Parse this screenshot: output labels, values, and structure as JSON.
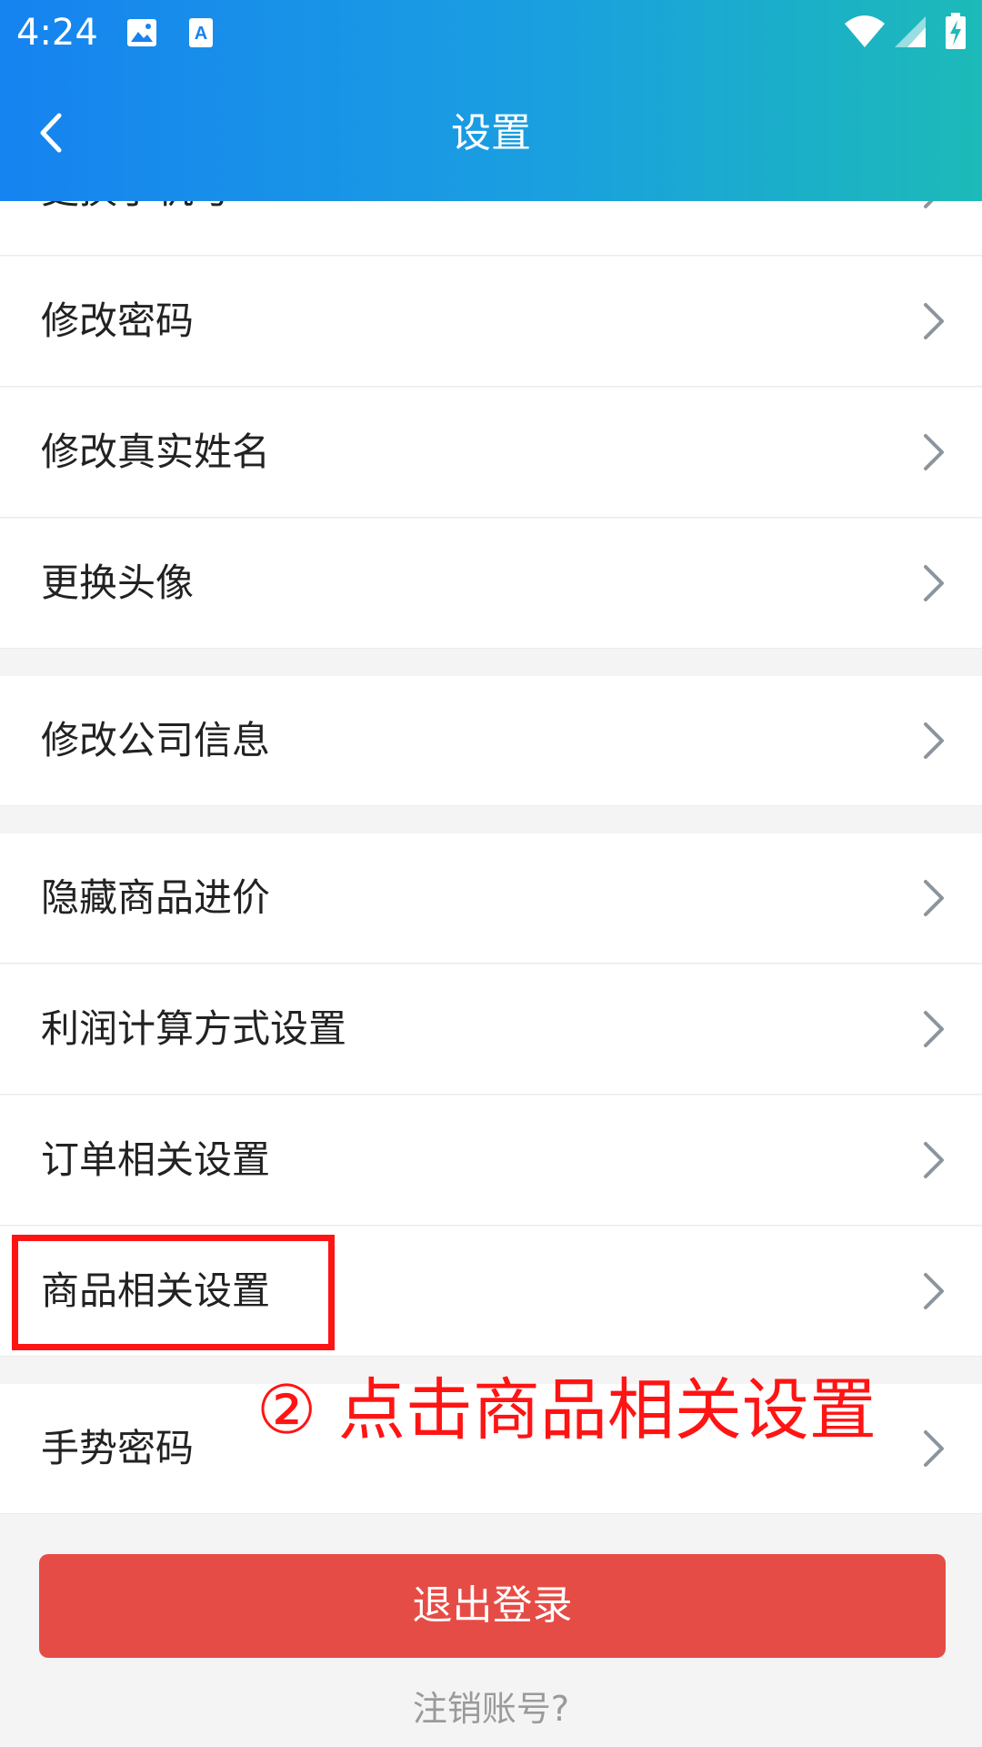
{
  "status_bar": {
    "time": "4:24",
    "left_icons": [
      "image-icon",
      "app-a-icon"
    ],
    "right_icons": [
      "wifi-icon",
      "signal-icon",
      "battery-charging-icon"
    ]
  },
  "header": {
    "title": "设置",
    "back_icon": "chevron-left-icon",
    "gradient_colors": [
      "#1683f0",
      "#1cbab8"
    ]
  },
  "settings": {
    "items": [
      {
        "label": "更换手机号",
        "name": "row-change-phone"
      },
      {
        "label": "修改密码",
        "name": "row-change-password"
      },
      {
        "label": "修改真实姓名",
        "name": "row-change-real-name"
      },
      {
        "label": "更换头像",
        "name": "row-change-avatar"
      },
      {
        "label": "修改公司信息",
        "name": "row-edit-company-info"
      },
      {
        "label": "隐藏商品进价",
        "name": "row-hide-purchase-price"
      },
      {
        "label": "利润计算方式设置",
        "name": "row-profit-calculation"
      },
      {
        "label": "订单相关设置",
        "name": "row-order-settings"
      },
      {
        "label": "商品相关设置",
        "name": "row-product-settings"
      },
      {
        "label": "手势密码",
        "name": "row-gesture-password"
      }
    ]
  },
  "annotation": {
    "text": "② 点击商品相关设置",
    "color": "#ff1414"
  },
  "logout": {
    "label": "退出登录",
    "color": "#e64c46"
  },
  "deregister": {
    "label": "注销账号?"
  }
}
